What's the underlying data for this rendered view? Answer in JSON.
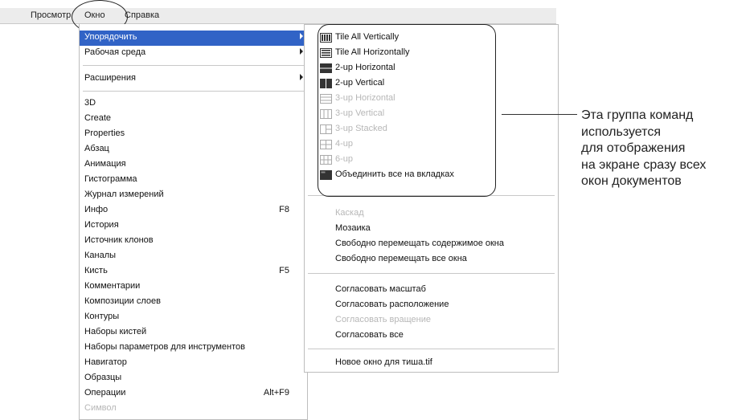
{
  "menubar": {
    "view": "Просмотр",
    "window": "Окно",
    "help": "Справка"
  },
  "left_menu": {
    "top_items": [
      {
        "label": "Упорядочить",
        "submenu": true,
        "selected": true
      },
      {
        "label": "Рабочая среда",
        "submenu": true
      },
      {
        "label": "Расширения",
        "submenu": true
      }
    ],
    "panels": [
      {
        "label": "3D"
      },
      {
        "label": "Create"
      },
      {
        "label": "Properties"
      },
      {
        "label": "Абзац"
      },
      {
        "label": "Анимация"
      },
      {
        "label": "Гистограмма"
      },
      {
        "label": "Журнал измерений"
      },
      {
        "label": "Инфо",
        "shortcut": "F8"
      },
      {
        "label": "История"
      },
      {
        "label": "Источник клонов"
      },
      {
        "label": "Каналы"
      },
      {
        "label": "Кисть",
        "shortcut": "F5"
      },
      {
        "label": "Комментарии"
      },
      {
        "label": "Композиции слоев"
      },
      {
        "label": "Контуры"
      },
      {
        "label": "Наборы кистей"
      },
      {
        "label": "Наборы параметров для инструментов"
      },
      {
        "label": "Навигатор"
      },
      {
        "label": "Образцы"
      },
      {
        "label": "Операции",
        "shortcut": "Alt+F9"
      },
      {
        "label": "Символ",
        "faded": true
      }
    ]
  },
  "submenu": {
    "layout_items": [
      {
        "label": "Tile All Vertically",
        "icon": "tile-vertical-icon",
        "enabled": true
      },
      {
        "label": "Tile All Horizontally",
        "icon": "tile-horizontal-icon",
        "enabled": true
      },
      {
        "label": "2-up Horizontal",
        "icon": "two-up-horizontal-icon",
        "enabled": true
      },
      {
        "label": "2-up Vertical",
        "icon": "two-up-vertical-icon",
        "enabled": true
      },
      {
        "label": "3-up Horizontal",
        "icon": "three-up-horizontal-icon",
        "enabled": false
      },
      {
        "label": "3-up Vertical",
        "icon": "three-up-vertical-icon",
        "enabled": false
      },
      {
        "label": "3-up Stacked",
        "icon": "three-up-stacked-icon",
        "enabled": false
      },
      {
        "label": "4-up",
        "icon": "four-up-icon",
        "enabled": false
      },
      {
        "label": "6-up",
        "icon": "six-up-icon",
        "enabled": false
      },
      {
        "label": "Объединить все на вкладках",
        "icon": "consolidate-tabs-icon",
        "enabled": true
      }
    ],
    "group2": [
      {
        "label": "Каскад",
        "enabled": false
      },
      {
        "label": "Мозаика",
        "enabled": true
      },
      {
        "label": "Свободно перемещать содержимое окна",
        "enabled": true
      },
      {
        "label": "Свободно перемещать все окна",
        "enabled": true
      }
    ],
    "group3": [
      {
        "label": "Согласовать масштаб",
        "enabled": true
      },
      {
        "label": "Согласовать расположение",
        "enabled": true
      },
      {
        "label": "Согласовать вращение",
        "enabled": false
      },
      {
        "label": "Согласовать все",
        "enabled": true
      }
    ],
    "group4": [
      {
        "label": "Новое окно для тиша.tif",
        "enabled": true
      }
    ]
  },
  "callout": {
    "lines": [
      "Эта группа команд",
      "используется",
      "для отображения",
      "на экране сразу всех",
      "окон документов"
    ]
  },
  "colors": {
    "selection": "#3163c6",
    "disabled_text": "#b7b7b7"
  }
}
